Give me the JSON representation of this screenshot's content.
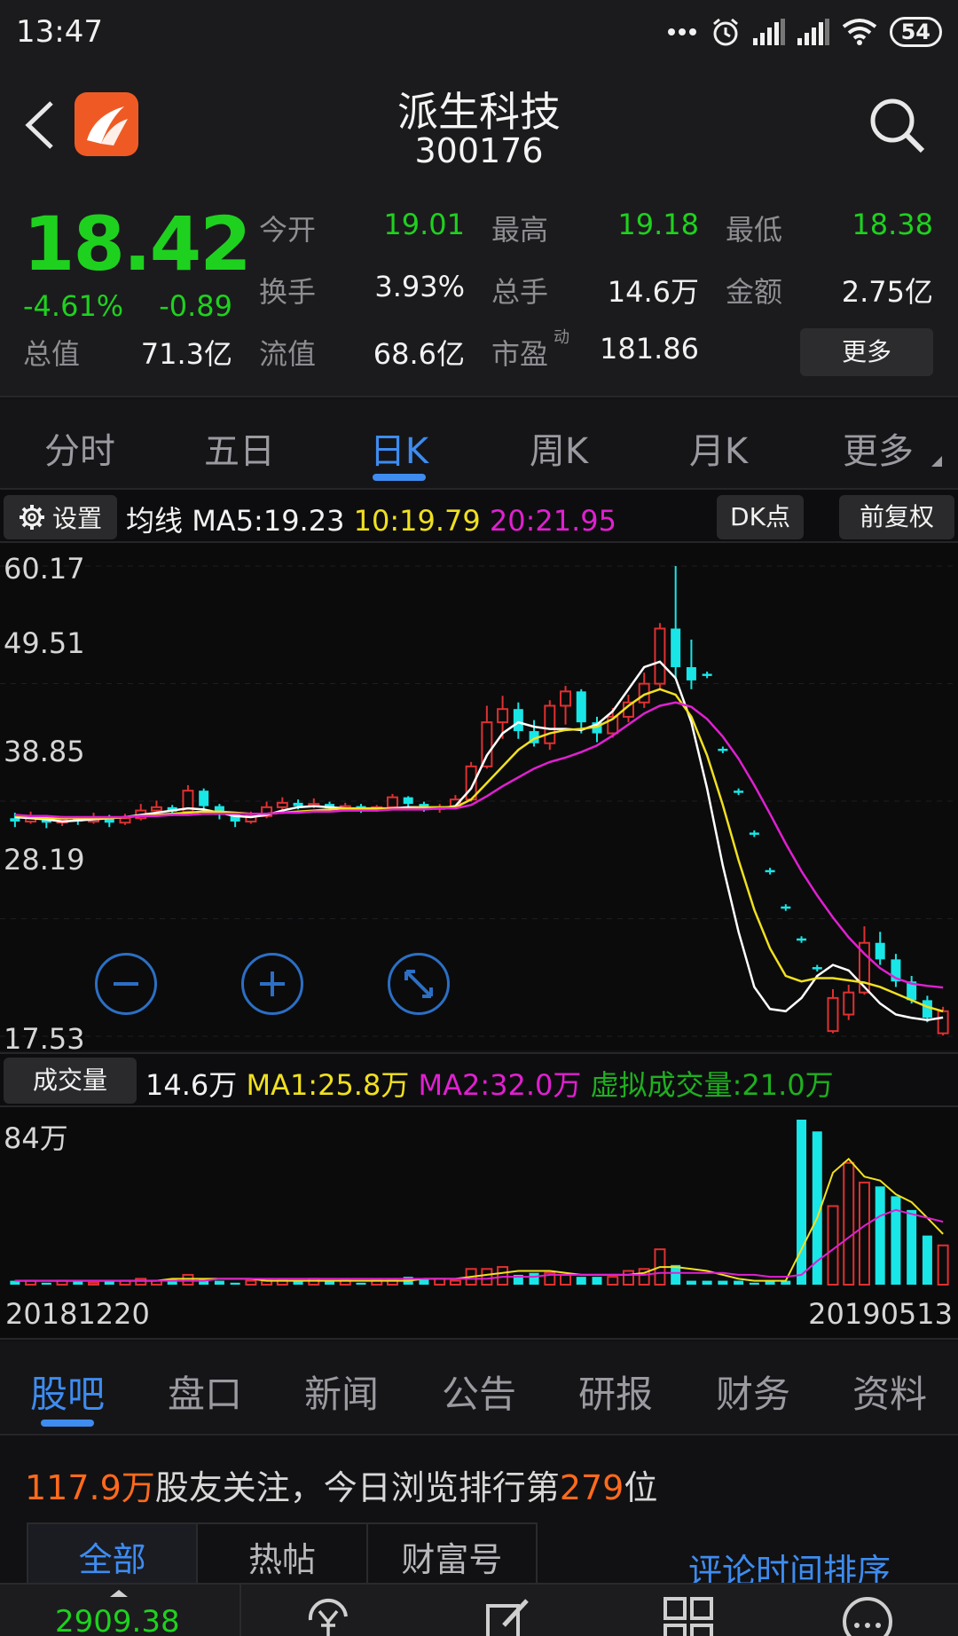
{
  "status_bar": {
    "time": "13:47",
    "battery": "54"
  },
  "header": {
    "title": "派生科技",
    "code": "300176"
  },
  "quote": {
    "price": "18.42",
    "change_pct": "-4.61%",
    "change": "-0.89",
    "stats": [
      {
        "label": "今开",
        "value": "19.01",
        "color": "green"
      },
      {
        "label": "最高",
        "value": "19.18",
        "color": "green"
      },
      {
        "label": "最低",
        "value": "18.38",
        "color": "green"
      },
      {
        "label": "换手",
        "value": "3.93%",
        "color": "white"
      },
      {
        "label": "总手",
        "value": "14.6万",
        "color": "white"
      },
      {
        "label": "金额",
        "value": "2.75亿",
        "color": "white"
      },
      {
        "label": "总值",
        "value": "71.3亿",
        "color": "white"
      },
      {
        "label": "流值",
        "value": "68.6亿",
        "color": "white"
      },
      {
        "label": "市盈",
        "value": "181.86",
        "color": "white",
        "sup": "动"
      }
    ],
    "more_label": "更多"
  },
  "period_tabs": [
    "分时",
    "五日",
    "日K",
    "周K",
    "月K",
    "更多"
  ],
  "active_period": 2,
  "ma_bar": {
    "settings_label": "设置",
    "prefix": "均线",
    "ma5": "MA5:19.23",
    "ma10": "10:19.79",
    "ma20": "20:21.95",
    "dk_label": "DK点",
    "adjust_label": "前复权"
  },
  "colors": {
    "up": "#e03030",
    "down": "#19e6e6",
    "ma5": "#ffffff",
    "ma10": "#f0e020",
    "ma20": "#e020d0",
    "accent": "#3e8cf0",
    "green": "#1fd11f",
    "orange": "#ff6a1c"
  },
  "kchart": {
    "y_labels": [
      "60.17",
      "49.51",
      "38.85",
      "28.19",
      "17.53"
    ],
    "zoom_icons": [
      "zoom-out-icon",
      "zoom-in-icon",
      "fullscreen-icon"
    ]
  },
  "chart_data": {
    "type": "candlestick",
    "x_start": "20181220",
    "x_end": "20190513",
    "ylim": [
      17.53,
      60.17
    ],
    "ma_series": [
      {
        "name": "MA5",
        "values": [
          37.4,
          37.3,
          37.2,
          37.0,
          37.1,
          37.2,
          37.3,
          37.4,
          37.6,
          37.8,
          38.0,
          38.2,
          38.1,
          37.8,
          37.5,
          37.4,
          37.6,
          38.0,
          38.3,
          38.4,
          38.3,
          38.2,
          38.1,
          38.1,
          38.2,
          38.3,
          38.3,
          38.2,
          38.4,
          40.0,
          43.0,
          45.0,
          46.0,
          45.6,
          45.4,
          45.4,
          45.3,
          45.8,
          47.0,
          49.0,
          51.0,
          51.5,
          50.0,
          46.0,
          40.0,
          33.0,
          27.0,
          22.0,
          20.0,
          19.8,
          21.0,
          23.0,
          24.0,
          23.5,
          22.0,
          20.5,
          19.5,
          19.2,
          19.0,
          19.23
        ]
      },
      {
        "name": "MA10",
        "values": [
          37.5,
          37.4,
          37.3,
          37.3,
          37.3,
          37.3,
          37.3,
          37.4,
          37.5,
          37.6,
          37.7,
          37.8,
          37.9,
          37.9,
          37.8,
          37.7,
          37.7,
          37.8,
          37.9,
          38.0,
          38.1,
          38.2,
          38.2,
          38.2,
          38.2,
          38.2,
          38.3,
          38.3,
          38.3,
          39.0,
          40.5,
          42.0,
          43.5,
          44.5,
          45.0,
          45.3,
          45.4,
          45.6,
          46.3,
          47.5,
          48.5,
          49.0,
          48.5,
          46.5,
          43.0,
          38.5,
          33.5,
          29.0,
          25.5,
          23.0,
          22.5,
          22.8,
          22.8,
          22.6,
          22.4,
          22.0,
          21.4,
          20.8,
          20.2,
          19.79
        ]
      },
      {
        "name": "MA20",
        "values": [
          37.6,
          37.5,
          37.5,
          37.4,
          37.4,
          37.4,
          37.4,
          37.4,
          37.5,
          37.5,
          37.6,
          37.6,
          37.7,
          37.7,
          37.7,
          37.7,
          37.7,
          37.8,
          37.8,
          37.9,
          37.9,
          38.0,
          38.0,
          38.0,
          38.1,
          38.1,
          38.1,
          38.2,
          38.2,
          38.5,
          39.3,
          40.2,
          41.0,
          41.8,
          42.4,
          42.8,
          43.3,
          43.9,
          44.8,
          45.8,
          46.8,
          47.5,
          47.8,
          47.4,
          46.3,
          44.7,
          42.7,
          40.3,
          37.7,
          35.0,
          32.5,
          30.3,
          28.3,
          26.5,
          25.0,
          23.7,
          22.8,
          22.3,
          22.1,
          21.95
        ]
      }
    ],
    "candles": [
      {
        "o": 37.3,
        "c": 37.0,
        "h": 37.8,
        "l": 36.5
      },
      {
        "o": 37.0,
        "c": 37.4,
        "h": 37.9,
        "l": 36.8
      },
      {
        "o": 37.4,
        "c": 36.9,
        "h": 37.6,
        "l": 36.4
      },
      {
        "o": 36.9,
        "c": 37.2,
        "h": 37.5,
        "l": 36.6
      },
      {
        "o": 37.2,
        "c": 37.0,
        "h": 37.4,
        "l": 36.7
      },
      {
        "o": 37.0,
        "c": 37.4,
        "h": 37.8,
        "l": 36.8
      },
      {
        "o": 37.4,
        "c": 36.9,
        "h": 37.6,
        "l": 36.5
      },
      {
        "o": 36.9,
        "c": 37.3,
        "h": 37.7,
        "l": 36.7
      },
      {
        "o": 37.3,
        "c": 38.0,
        "h": 38.6,
        "l": 37.1
      },
      {
        "o": 38.0,
        "c": 38.3,
        "h": 38.9,
        "l": 37.7
      },
      {
        "o": 38.3,
        "c": 37.9,
        "h": 38.5,
        "l": 37.5
      },
      {
        "o": 37.9,
        "c": 39.8,
        "h": 40.3,
        "l": 37.7
      },
      {
        "o": 39.8,
        "c": 38.4,
        "h": 40.0,
        "l": 38.0
      },
      {
        "o": 38.4,
        "c": 37.6,
        "h": 38.6,
        "l": 37.2
      },
      {
        "o": 37.6,
        "c": 37.0,
        "h": 37.8,
        "l": 36.5
      },
      {
        "o": 37.0,
        "c": 37.5,
        "h": 37.9,
        "l": 36.8
      },
      {
        "o": 37.5,
        "c": 38.3,
        "h": 38.8,
        "l": 37.3
      },
      {
        "o": 38.3,
        "c": 38.7,
        "h": 39.2,
        "l": 38.0
      },
      {
        "o": 38.7,
        "c": 38.4,
        "h": 39.0,
        "l": 38.1
      },
      {
        "o": 38.4,
        "c": 38.6,
        "h": 39.1,
        "l": 38.2
      },
      {
        "o": 38.6,
        "c": 38.2,
        "h": 38.8,
        "l": 37.9
      },
      {
        "o": 38.2,
        "c": 38.4,
        "h": 38.7,
        "l": 37.9
      },
      {
        "o": 38.4,
        "c": 38.1,
        "h": 38.6,
        "l": 37.8
      },
      {
        "o": 38.1,
        "c": 38.3,
        "h": 38.5,
        "l": 37.9
      },
      {
        "o": 38.3,
        "c": 39.2,
        "h": 39.5,
        "l": 38.1
      },
      {
        "o": 39.2,
        "c": 38.6,
        "h": 39.3,
        "l": 38.3
      },
      {
        "o": 38.6,
        "c": 38.2,
        "h": 38.8,
        "l": 37.9
      },
      {
        "o": 38.2,
        "c": 38.3,
        "h": 38.6,
        "l": 37.8
      },
      {
        "o": 38.3,
        "c": 39.0,
        "h": 39.4,
        "l": 38.1
      },
      {
        "o": 39.0,
        "c": 42.0,
        "h": 42.4,
        "l": 38.8
      },
      {
        "o": 42.0,
        "c": 46.0,
        "h": 47.5,
        "l": 41.8
      },
      {
        "o": 46.0,
        "c": 47.2,
        "h": 48.4,
        "l": 44.5
      },
      {
        "o": 47.2,
        "c": 45.2,
        "h": 47.8,
        "l": 44.5
      },
      {
        "o": 45.2,
        "c": 44.1,
        "h": 46.2,
        "l": 43.8
      },
      {
        "o": 44.1,
        "c": 47.5,
        "h": 48.0,
        "l": 43.5
      },
      {
        "o": 47.5,
        "c": 48.8,
        "h": 49.3,
        "l": 45.8
      },
      {
        "o": 48.8,
        "c": 46.0,
        "h": 49.0,
        "l": 45.0
      },
      {
        "o": 46.0,
        "c": 45.0,
        "h": 46.5,
        "l": 44.2
      },
      {
        "o": 45.0,
        "c": 46.5,
        "h": 47.3,
        "l": 44.6
      },
      {
        "o": 46.5,
        "c": 47.8,
        "h": 48.5,
        "l": 46.0
      },
      {
        "o": 47.8,
        "c": 49.5,
        "h": 50.5,
        "l": 47.3
      },
      {
        "o": 49.5,
        "c": 54.5,
        "h": 55.0,
        "l": 49.0
      },
      {
        "o": 54.5,
        "c": 51.0,
        "h": 60.17,
        "l": 50.0
      },
      {
        "o": 51.0,
        "c": 49.8,
        "h": 53.5,
        "l": 49.0
      },
      {
        "o": 50.4,
        "c": 50.2,
        "h": 50.6,
        "l": 50.0
      },
      {
        "o": 43.6,
        "c": 43.4,
        "h": 43.8,
        "l": 43.2
      },
      {
        "o": 39.8,
        "c": 39.6,
        "h": 40.0,
        "l": 39.4
      },
      {
        "o": 36.0,
        "c": 35.8,
        "h": 36.2,
        "l": 35.6
      },
      {
        "o": 32.6,
        "c": 32.4,
        "h": 32.8,
        "l": 32.2
      },
      {
        "o": 29.3,
        "c": 29.1,
        "h": 29.5,
        "l": 28.9
      },
      {
        "o": 26.4,
        "c": 26.2,
        "h": 26.6,
        "l": 26.0
      },
      {
        "o": 23.8,
        "c": 23.6,
        "h": 24.0,
        "l": 23.4
      },
      {
        "o": 18.0,
        "c": 21.0,
        "h": 21.8,
        "l": 17.8
      },
      {
        "o": 19.5,
        "c": 21.5,
        "h": 22.2,
        "l": 19.0
      },
      {
        "o": 21.5,
        "c": 26.0,
        "h": 27.5,
        "l": 21.3
      },
      {
        "o": 26.0,
        "c": 24.5,
        "h": 27.0,
        "l": 24.0
      },
      {
        "o": 24.5,
        "c": 22.5,
        "h": 25.0,
        "l": 22.0
      },
      {
        "o": 22.5,
        "c": 20.8,
        "h": 23.0,
        "l": 20.5
      },
      {
        "o": 20.8,
        "c": 19.2,
        "h": 21.2,
        "l": 18.8
      },
      {
        "o": 17.8,
        "c": 19.8,
        "h": 20.2,
        "l": 17.6
      }
    ],
    "volume": {
      "max_label": "84万",
      "values": [
        2,
        2,
        1,
        2,
        2,
        1,
        2,
        2,
        3,
        2,
        3,
        5,
        3,
        2,
        1,
        2,
        2,
        2,
        2,
        3,
        2,
        2,
        1,
        2,
        2,
        4,
        3,
        3,
        2,
        8,
        8,
        9,
        5,
        6,
        6,
        5,
        4,
        4,
        4,
        7,
        8,
        18,
        10,
        2,
        2,
        2,
        2,
        1,
        2,
        2,
        84,
        78,
        40,
        62,
        52,
        50,
        45,
        38,
        25,
        20
      ],
      "ma1": [
        2,
        2,
        2,
        2,
        2,
        2,
        2,
        2,
        2,
        2,
        3,
        3,
        3,
        3,
        3,
        3,
        2,
        2,
        2,
        2,
        2,
        2,
        2,
        2,
        2,
        2,
        3,
        3,
        3,
        4,
        5,
        6,
        7,
        7,
        7,
        6,
        5,
        5,
        5,
        5,
        6,
        9,
        9,
        8,
        7,
        5,
        3,
        2,
        2,
        2,
        18,
        34,
        57,
        64,
        55,
        53,
        46,
        42,
        34,
        25.8
      ],
      "ma2": [
        2,
        2,
        2,
        2,
        2,
        2,
        2,
        2,
        2,
        2,
        2,
        2,
        2,
        3,
        3,
        3,
        3,
        3,
        3,
        3,
        3,
        3,
        3,
        3,
        3,
        3,
        3,
        3,
        3,
        3,
        3,
        4,
        4,
        4,
        5,
        5,
        5,
        5,
        5,
        5,
        5,
        6,
        6,
        6,
        6,
        6,
        5,
        5,
        4,
        4,
        5,
        12,
        18,
        24,
        30,
        35,
        38,
        36,
        34,
        32.0
      ]
    }
  },
  "vol_bar": {
    "button_label": "成交量",
    "current": "14.6万",
    "ma1": "MA1:25.8万",
    "ma2": "MA2:32.0万",
    "virtual": "虚拟成交量:21.0万"
  },
  "info_tabs": [
    "股吧",
    "盘口",
    "新闻",
    "公告",
    "研报",
    "财务",
    "资料"
  ],
  "active_info_tab": 0,
  "fans": {
    "count": "117.9万",
    "text1": "股友关注，今日浏览排行第",
    "rank": "279",
    "text2": "位"
  },
  "sub_tabs": [
    "全部",
    "热帖",
    "财富号"
  ],
  "sort_label": "评论时间排序",
  "bottom_nav": {
    "index_value": "2909.38",
    "icons": [
      "yuan-refresh-icon",
      "edit-icon",
      "grid-icon",
      "more-icon"
    ]
  }
}
